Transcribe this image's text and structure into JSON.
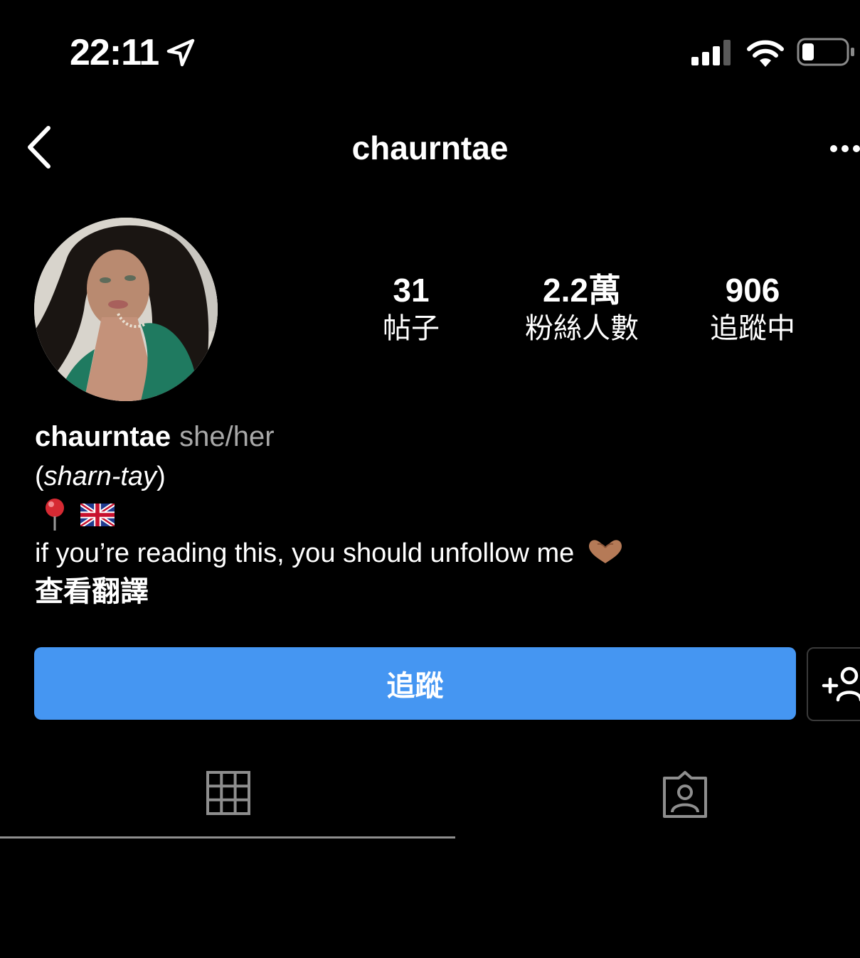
{
  "status_bar": {
    "time": "22:11",
    "icons": [
      "location-arrow-icon",
      "cellular-signal-icon",
      "wifi-icon",
      "battery-icon"
    ]
  },
  "header": {
    "title": "chaurntae",
    "back_icon": "chevron-left-icon",
    "more_icon": "more-horizontal-icon"
  },
  "profile": {
    "stats": [
      {
        "value": "31",
        "label": "帖子"
      },
      {
        "value": "2.2萬",
        "label": "粉絲人數"
      },
      {
        "value": "906",
        "label": "追蹤中"
      }
    ]
  },
  "bio": {
    "name": "chaurntae",
    "pronouns": "she/her",
    "pronunciation_open": "(",
    "pronunciation": "sharn-tay",
    "pronunciation_close": ")",
    "emoji_line": "📍 🇬🇧",
    "text": "if you’re reading this, you should unfollow me 🫶🏽",
    "translate_label": "查看翻譯"
  },
  "actions": {
    "follow_label": "追蹤",
    "suggest_icon": "add-user-icon"
  },
  "tabs": {
    "active": "posts",
    "items": [
      {
        "id": "posts",
        "icon": "grid-icon"
      },
      {
        "id": "tagged",
        "icon": "tagged-person-icon"
      }
    ]
  },
  "colors": {
    "background": "#000000",
    "primary_button": "#4596f2",
    "secondary_text": "#a8a8a8",
    "tab_indicator": "#8e8e8e"
  }
}
